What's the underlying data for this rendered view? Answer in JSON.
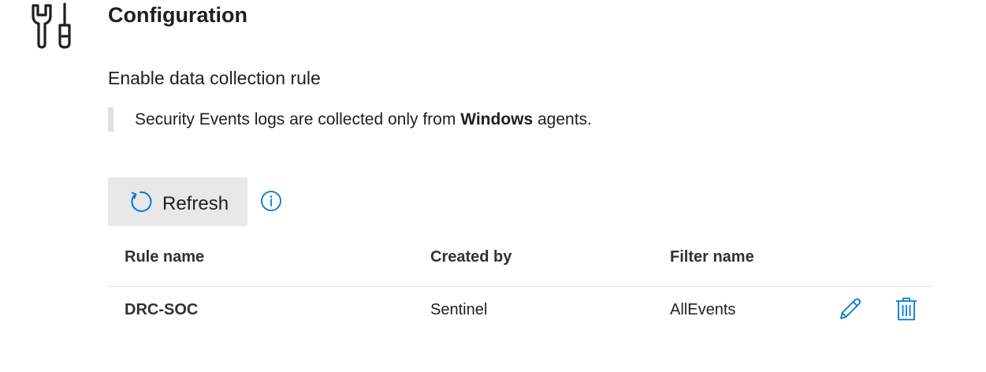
{
  "section": {
    "icon": "wrench-screwdriver-icon",
    "title": "Configuration"
  },
  "subsection": {
    "title": "Enable data collection rule"
  },
  "notice": {
    "text_before": "Security Events logs are collected only from ",
    "text_bold": "Windows",
    "text_after": " agents."
  },
  "toolbar": {
    "refresh_label": "Refresh",
    "refresh_icon": "refresh-icon",
    "info_icon": "info-icon"
  },
  "table": {
    "columns": [
      "Rule name",
      "Created by",
      "Filter name"
    ],
    "rows": [
      {
        "rule_name": "DRC-SOC",
        "created_by": "Sentinel",
        "filter_name": "AllEvents",
        "actions": [
          "edit-icon",
          "delete-icon"
        ]
      }
    ]
  },
  "colors": {
    "accent": "#0078d4",
    "text": "#201f1e",
    "button_bg": "#e8e8e8",
    "divider": "#e1dfdd"
  }
}
